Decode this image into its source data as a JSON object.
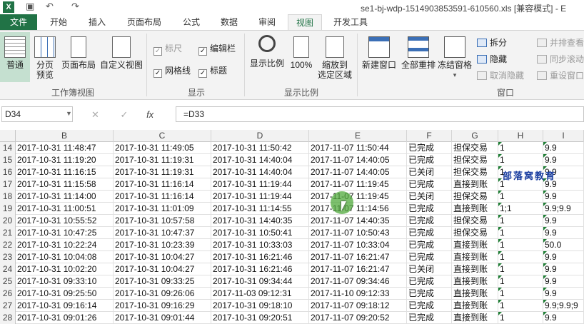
{
  "window": {
    "title": "se1-bj-wdp-1514903853591-610560.xls  [兼容模式] - E",
    "app_icon": "X"
  },
  "tabs": [
    {
      "label": "文件",
      "active": false,
      "file": true
    },
    {
      "label": "开始",
      "active": false
    },
    {
      "label": "插入",
      "active": false
    },
    {
      "label": "页面布局",
      "active": false
    },
    {
      "label": "公式",
      "active": false
    },
    {
      "label": "数据",
      "active": false
    },
    {
      "label": "审阅",
      "active": false
    },
    {
      "label": "视图",
      "active": true
    },
    {
      "label": "开发工具",
      "active": false
    }
  ],
  "ribbon": {
    "workbook_views": {
      "group": "工作簿视图",
      "normal": "普通",
      "page_break_l1": "分页",
      "page_break_l2": "预览",
      "page_layout": "页面布局",
      "custom_views": "自定义视图"
    },
    "show": {
      "group": "显示",
      "ruler": "标尺",
      "formula_bar": "编辑栏",
      "gridlines": "网格线",
      "headings": "标题"
    },
    "zoom": {
      "group": "显示比例",
      "zoom": "显示比例",
      "zoom100": "100%",
      "zoom_sel_l1": "缩放到",
      "zoom_sel_l2": "选定区域"
    },
    "window": {
      "group": "窗口",
      "new_window": "新建窗口",
      "arrange_all": "全部重排",
      "freeze_panes": "冻结窗格",
      "split": "拆分",
      "hide": "隐藏",
      "unhide": "取消隐藏",
      "side_by_side": "并排查看",
      "sync_scroll": "同步滚动",
      "reset_position": "重设窗口"
    }
  },
  "formula_bar": {
    "name_box": "D34",
    "formula": "=D33",
    "fx": "fx"
  },
  "columns": [
    "B",
    "C",
    "D",
    "E",
    "F",
    "G",
    "H",
    "I"
  ],
  "rows": [
    {
      "n": "14",
      "b": "2017-10-31 11:48:47",
      "c": "2017-10-31 11:49:05",
      "d": "2017-10-31 11:50:42",
      "e": "2017-11-07 11:50:44",
      "f": "已完成",
      "g": "担保交易",
      "h": "1",
      "i": "9.9"
    },
    {
      "n": "15",
      "b": "2017-10-31 11:19:20",
      "c": "2017-10-31 11:19:31",
      "d": "2017-10-31 14:40:04",
      "e": "2017-11-07 14:40:05",
      "f": "已完成",
      "g": "担保交易",
      "h": "1",
      "i": "9.9"
    },
    {
      "n": "16",
      "b": "2017-10-31 11:16:15",
      "c": "2017-10-31 11:19:31",
      "d": "2017-10-31 14:40:04",
      "e": "2017-11-07 14:40:05",
      "f": "已关闭",
      "g": "担保交易",
      "h": "1",
      "i": "9.9"
    },
    {
      "n": "17",
      "b": "2017-10-31 11:15:58",
      "c": "2017-10-31 11:16:14",
      "d": "2017-10-31 11:19:44",
      "e": "2017-11-07 11:19:45",
      "f": "已完成",
      "g": "直接到账",
      "h": "1",
      "i": "9.9"
    },
    {
      "n": "18",
      "b": "2017-10-31 11:14:00",
      "c": "2017-10-31 11:16:14",
      "d": "2017-10-31 11:19:44",
      "e": "2017-11-07 11:19:45",
      "f": "已关闭",
      "g": "担保交易",
      "h": "1",
      "i": "9.9"
    },
    {
      "n": "19",
      "b": "2017-10-31 11:00:51",
      "c": "2017-10-31 11:01:09",
      "d": "2017-10-31 11:14:55",
      "e": "2017-11-07 11:14:56",
      "f": "已完成",
      "g": "直接到账",
      "h": "1;1",
      "i": "9.9;9.9"
    },
    {
      "n": "20",
      "b": "2017-10-31 10:55:52",
      "c": "2017-10-31 10:57:58",
      "d": "2017-10-31 14:40:35",
      "e": "2017-11-07 14:40:35",
      "f": "已完成",
      "g": "担保交易",
      "h": "1",
      "i": "9.9"
    },
    {
      "n": "21",
      "b": "2017-10-31 10:47:25",
      "c": "2017-10-31 10:47:37",
      "d": "2017-10-31 10:50:41",
      "e": "2017-11-07 10:50:43",
      "f": "已完成",
      "g": "担保交易",
      "h": "1",
      "i": "9.9"
    },
    {
      "n": "22",
      "b": "2017-10-31 10:22:24",
      "c": "2017-10-31 10:23:39",
      "d": "2017-10-31 10:33:03",
      "e": "2017-11-07 10:33:04",
      "f": "已完成",
      "g": "直接到账",
      "h": "1",
      "i": "50.0"
    },
    {
      "n": "23",
      "b": "2017-10-31 10:04:08",
      "c": "2017-10-31 10:04:27",
      "d": "2017-10-31 16:21:46",
      "e": "2017-11-07 16:21:47",
      "f": "已完成",
      "g": "直接到账",
      "h": "1",
      "i": "9.9"
    },
    {
      "n": "24",
      "b": "2017-10-31 10:02:20",
      "c": "2017-10-31 10:04:27",
      "d": "2017-10-31 16:21:46",
      "e": "2017-11-07 16:21:47",
      "f": "已关闭",
      "g": "直接到账",
      "h": "1",
      "i": "9.9"
    },
    {
      "n": "25",
      "b": "2017-10-31 09:33:10",
      "c": "2017-10-31 09:33:25",
      "d": "2017-10-31 09:34:44",
      "e": "2017-11-07 09:34:46",
      "f": "已完成",
      "g": "直接到账",
      "h": "1",
      "i": "9.9"
    },
    {
      "n": "26",
      "b": "2017-10-31 09:25:50",
      "c": "2017-10-31 09:26:06",
      "d": "2017-11-03 09:12:31",
      "e": "2017-11-10 09:12:33",
      "f": "已完成",
      "g": "直接到账",
      "h": "1",
      "i": "9.9"
    },
    {
      "n": "27",
      "b": "2017-10-31 09:16:14",
      "c": "2017-10-31 09:16:29",
      "d": "2017-10-31 09:18:10",
      "e": "2017-11-07 09:18:12",
      "f": "已完成",
      "g": "直接到账",
      "h": "1",
      "i": "9.9;9.9;9"
    },
    {
      "n": "28",
      "b": "2017-10-31 09:01:26",
      "c": "2017-10-31 09:01:44",
      "d": "2017-10-31 09:20:51",
      "e": "2017-11-07 09:20:52",
      "f": "已完成",
      "g": "直接到账",
      "h": "1",
      "i": "9.9"
    }
  ],
  "watermark": "部落窝教育",
  "colors": {
    "accent": "#217346",
    "ribbon_bg": "#f3f3f3"
  }
}
